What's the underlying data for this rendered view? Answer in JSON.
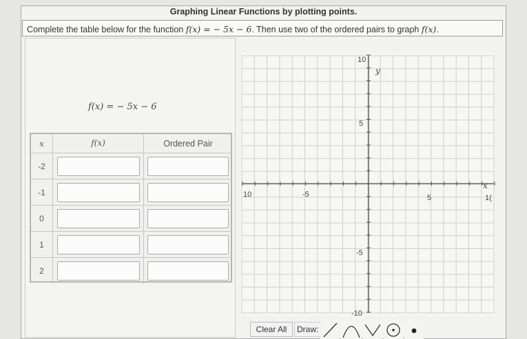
{
  "title": "Graphing Linear Functions by plotting points.",
  "instructions": {
    "prefix": "Complete the table below for the function",
    "function": "f(x) = − 5x − 6",
    "suffix": ". Then use two of the ordered pairs to graph",
    "fx": "f(x)",
    "end": "."
  },
  "function_label": "f(x) = − 5x − 6",
  "table": {
    "headers": [
      "x",
      "f(x)",
      "Ordered Pair"
    ],
    "x_values": [
      "-2",
      "-1",
      "0",
      "1",
      "2"
    ],
    "fx_values": [
      "",
      "",
      "",
      "",
      ""
    ],
    "pair_values": [
      "",
      "",
      "",
      "",
      ""
    ]
  },
  "graph": {
    "x_label": "x",
    "y_label": "y",
    "range": [
      -10,
      10
    ],
    "grid": true,
    "tick_labels": {
      "x_neg10": "10",
      "x_neg5": "-5",
      "x_pos5": "5",
      "x_pos10": "1(",
      "y_pos10": "10",
      "y_pos5": "5",
      "y_neg5": "-5",
      "y_neg10": "-10"
    }
  },
  "toolbar": {
    "clear_label": "Clear All",
    "draw_label": "Draw:",
    "tools": [
      "line-tool-icon",
      "parabola-tool-icon",
      "absolute-value-tool-icon",
      "circle-tool-icon",
      "point-tool-icon"
    ]
  },
  "colors": {
    "grid": "#cfcfcf",
    "axis": "#555555",
    "background": "#f4f4f2"
  }
}
